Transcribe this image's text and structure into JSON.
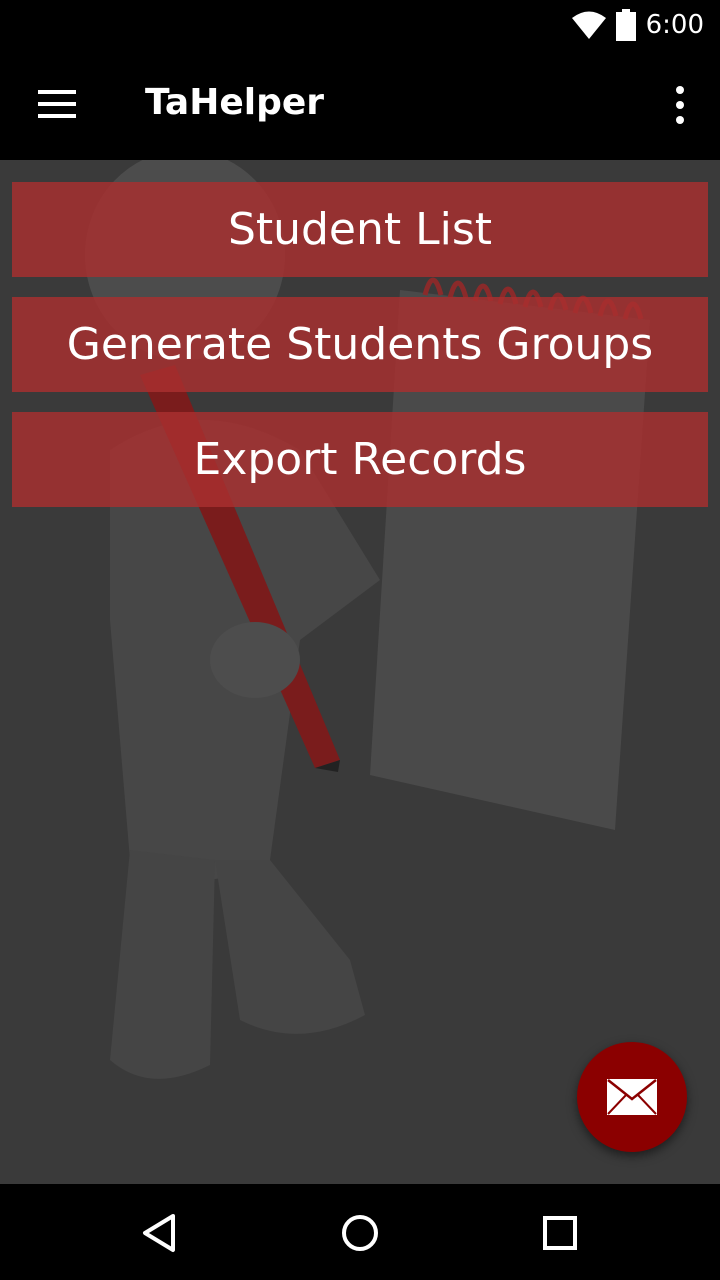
{
  "status_bar": {
    "time": "6:00",
    "icons": [
      "wifi-icon",
      "battery-icon"
    ]
  },
  "app_bar": {
    "title": "TaHelper",
    "nav_icon": "hamburger-menu-icon",
    "overflow_icon": "more-vert-icon"
  },
  "menu": {
    "items": [
      {
        "label": "Student List"
      },
      {
        "label": "Generate Students Groups"
      },
      {
        "label": "Export Records"
      }
    ]
  },
  "fab": {
    "icon": "mail-icon"
  },
  "nav_bar": {
    "icons": [
      "back-icon",
      "home-icon",
      "recents-icon"
    ]
  },
  "colors": {
    "button_fill": "#aa3030",
    "fab_fill": "#8b0000",
    "bar_background": "#000000",
    "content_background": "#3a3a3a"
  }
}
